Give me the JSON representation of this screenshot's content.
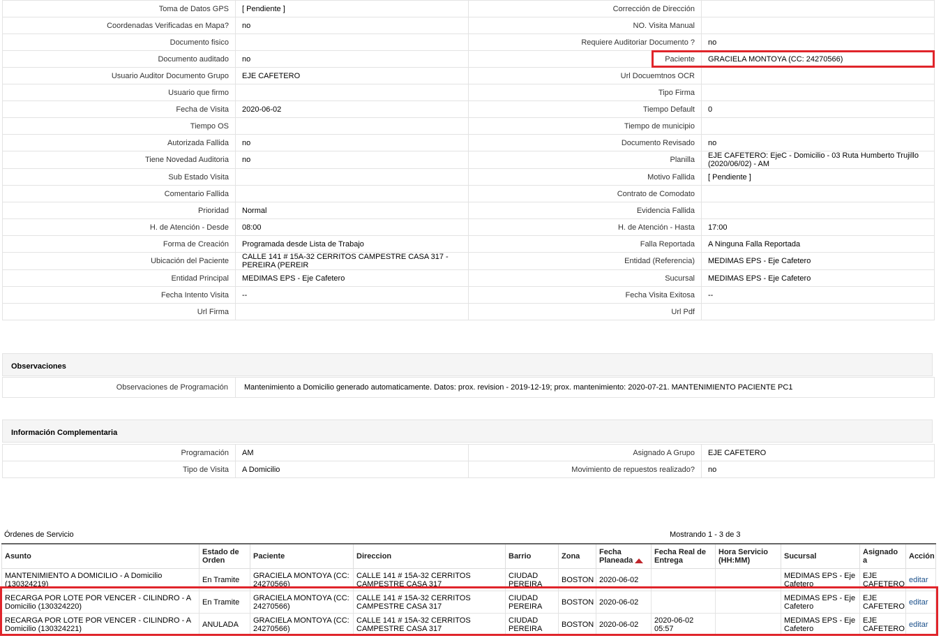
{
  "detail_rows": [
    {
      "l1": "Toma de Datos GPS",
      "v1": "[ Pendiente ]",
      "l2": "Corrección de Dirección",
      "v2": ""
    },
    {
      "l1": "Coordenadas Verificadas en Mapa?",
      "v1": "no",
      "l2": "NO. Visita Manual",
      "v2": ""
    },
    {
      "l1": "Documento fisico",
      "v1": "",
      "l2": "Requiere Auditoriar Documento ?",
      "v2": "no"
    },
    {
      "l1": "Documento auditado",
      "v1": "no",
      "l2": "Paciente",
      "v2": "GRACIELA MONTOYA (CC: 24270566)"
    },
    {
      "l1": "Usuario Auditor Documento Grupo",
      "v1": "EJE CAFETERO",
      "l2": "Url Docuemtnos OCR",
      "v2": ""
    },
    {
      "l1": "Usuario que firmo",
      "v1": "",
      "l2": "Tipo Firma",
      "v2": ""
    },
    {
      "l1": "Fecha de Visita",
      "v1": "2020-06-02",
      "l2": "Tiempo Default",
      "v2": "0"
    },
    {
      "l1": "Tiempo OS",
      "v1": "",
      "l2": "Tiempo de municipio",
      "v2": ""
    },
    {
      "l1": "Autorizada Fallida",
      "v1": "no",
      "l2": "Documento Revisado",
      "v2": "no"
    },
    {
      "l1": "Tiene Novedad Auditoria",
      "v1": "no",
      "l2": "Planilla",
      "v2": "EJE CAFETERO: EjeC - Domicilio - 03 Ruta Humberto Trujillo (2020/06/02) - AM"
    },
    {
      "l1": "Sub Estado Visita",
      "v1": "",
      "l2": "Motivo Fallida",
      "v2": "[ Pendiente ]"
    },
    {
      "l1": "Comentario Fallida",
      "v1": "",
      "l2": "Contrato de Comodato",
      "v2": ""
    },
    {
      "l1": "Prioridad",
      "v1": "Normal",
      "l2": "Evidencia Fallida",
      "v2": ""
    },
    {
      "l1": "H. de Atención - Desde",
      "v1": "08:00",
      "l2": "H. de Atención - Hasta",
      "v2": "17:00"
    },
    {
      "l1": "Forma de Creación",
      "v1": "Programada desde Lista de Trabajo",
      "l2": "Falla Reportada",
      "v2": "A Ninguna Falla Reportada"
    },
    {
      "l1": "Ubicación del Paciente",
      "v1": "CALLE 141 # 15A-32 CERRITOS CAMPESTRE CASA 317 - PEREIRA (PEREIR",
      "l2": "Entidad (Referencia)",
      "v2": "MEDIMAS EPS - Eje Cafetero"
    },
    {
      "l1": "Entidad Principal",
      "v1": "MEDIMAS EPS - Eje Cafetero",
      "l2": "Sucursal",
      "v2": "MEDIMAS EPS - Eje Cafetero"
    },
    {
      "l1": "Fecha Intento Visita",
      "v1": "--",
      "l2": "Fecha Visita Exitosa",
      "v2": "--"
    },
    {
      "l1": "Url Firma",
      "v1": "",
      "l2": "Url Pdf",
      "v2": ""
    }
  ],
  "observaciones": {
    "title": "Observaciones",
    "label": "Observaciones de Programación",
    "value": "Mantenimiento a Domicilio generado automaticamente. Datos: prox. revision - 2019-12-19; prox. mantenimiento: 2020-07-21. MANTENIMIENTO PACIENTE PC1"
  },
  "info": {
    "title": "Información Complementaria",
    "rows": [
      {
        "l1": "Programación",
        "v1": "AM",
        "l2": "Asignado A Grupo",
        "v2": "EJE CAFETERO"
      },
      {
        "l1": "Tipo de Visita",
        "v1": "A Domicilio",
        "l2": "Movimiento de repuestos realizado?",
        "v2": "no"
      }
    ]
  },
  "orders": {
    "title": "Órdenes de Servicio",
    "count": "Mostrando 1 - 3 de 3",
    "headers": [
      "Asunto",
      "Estado de Orden",
      "Paciente",
      "Direccion",
      "Barrio",
      "Zona",
      "Fecha Planeada",
      "Fecha Real de Entrega",
      "Hora Servicio (HH:MM)",
      "Sucursal",
      "Asignado a",
      "Acción"
    ],
    "rows": [
      [
        "MANTENIMIENTO A DOMICILIO - A Domicilio (130324219)",
        "En Tramite",
        "GRACIELA MONTOYA (CC: 24270566)",
        "CALLE 141 # 15A-32 CERRITOS CAMPESTRE CASA 317",
        "CIUDAD PEREIRA",
        "BOSTON",
        "2020-06-02",
        "",
        "",
        "MEDIMAS EPS - Eje Cafetero",
        "EJE CAFETERO",
        "editar"
      ],
      [
        "RECARGA POR LOTE POR VENCER - CILINDRO - A Domicilio (130324220)",
        "En Tramite",
        "GRACIELA MONTOYA (CC: 24270566)",
        "CALLE 141 # 15A-32 CERRITOS CAMPESTRE CASA 317",
        "CIUDAD PEREIRA",
        "BOSTON",
        "2020-06-02",
        "",
        "",
        "MEDIMAS EPS - Eje Cafetero",
        "EJE CAFETERO",
        "editar"
      ],
      [
        "RECARGA POR LOTE POR VENCER - CILINDRO - A Domicilio (130324221)",
        "ANULADA",
        "GRACIELA MONTOYA (CC: 24270566)",
        "CALLE 141 # 15A-32 CERRITOS CAMPESTRE CASA 317",
        "CIUDAD PEREIRA",
        "BOSTON",
        "2020-06-02",
        "2020-06-02 05:57",
        "",
        "MEDIMAS EPS - Eje Cafetero",
        "EJE CAFETERO",
        "editar"
      ]
    ]
  },
  "colors": {
    "highlight": "#e0252b",
    "sort_arrow": "#c0262c",
    "link": "#1a4f8a"
  }
}
